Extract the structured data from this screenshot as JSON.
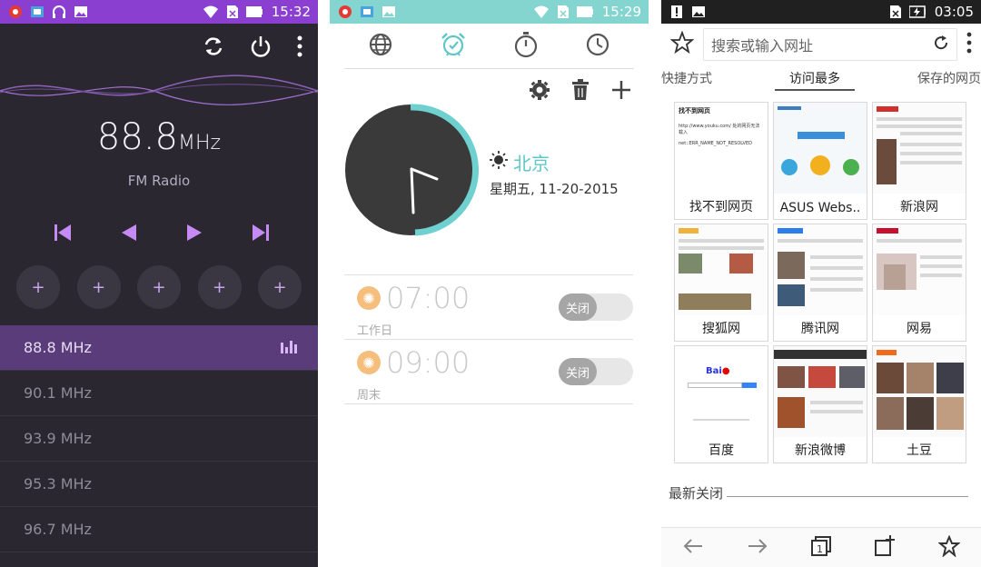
{
  "fm": {
    "status_time": "15:32",
    "frequency": "88.8",
    "frequency_unit": "MHz",
    "label": "FM Radio",
    "presets": [
      "+",
      "+",
      "+",
      "+",
      "+"
    ],
    "stations": [
      "88.8 MHz",
      "90.1 MHz",
      "93.9 MHz",
      "95.3 MHz",
      "96.7 MHz"
    ],
    "active_index": 0,
    "colors": {
      "accent": "#c68af5",
      "status_bar": "#8b3fd0",
      "bg": "#2a2730"
    }
  },
  "clock": {
    "status_time": "15:29",
    "city": "北京",
    "date": "星期五, 11-20-2015",
    "alarms": [
      {
        "time": "07:00",
        "label": "工作日",
        "toggle": "关闭"
      },
      {
        "time": "09:00",
        "label": "周末",
        "toggle": "关闭"
      }
    ],
    "colors": {
      "accent": "#5fc7c7",
      "status_bar": "#84d5d0"
    }
  },
  "browser": {
    "status_time": "03:05",
    "url_placeholder": "搜索或输入网址",
    "tabs": [
      "快捷方式",
      "访问最多",
      "保存的网页"
    ],
    "active_tab": 1,
    "tiles": [
      "找不到网页",
      "ASUS Webs..",
      "新浪网",
      "搜狐网",
      "腾讯网",
      "网易",
      "百度",
      "新浪微博",
      "土豆"
    ],
    "notfound_title": "找不到网页",
    "notfound_text": "http://www.youku.com/ 处的网页无法载入",
    "notfound_error": "net::ERR_NAME_NOT_RESOLVED",
    "recent_label": "最新关闭"
  }
}
